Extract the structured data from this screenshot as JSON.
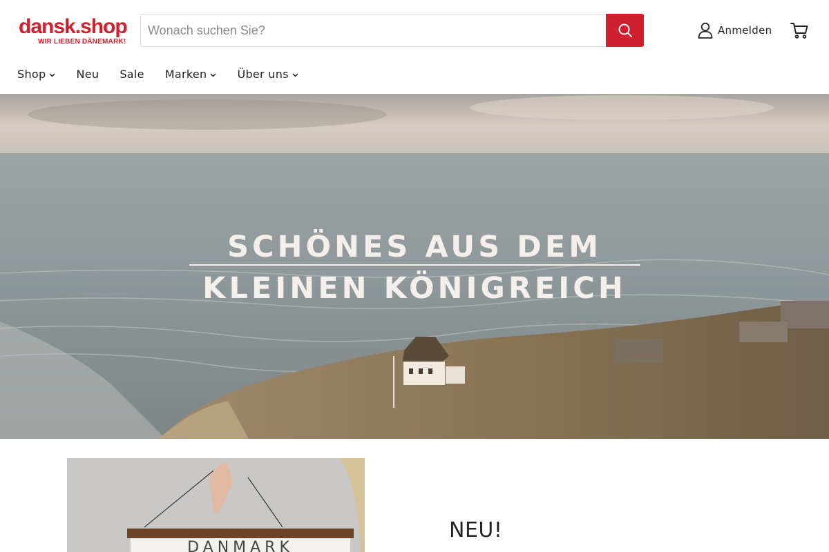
{
  "brand": {
    "logo_main": "dansk.shop",
    "logo_tagline": "WIR LIEBEN DÄNEMARK!",
    "color": "#d0202e"
  },
  "search": {
    "placeholder": "Wonach suchen Sie?",
    "value": "",
    "button_icon": "search-icon",
    "button_color": "#d0202e"
  },
  "account": {
    "label": "Anmelden",
    "icon": "user-icon"
  },
  "cart": {
    "icon": "cart-icon"
  },
  "nav": {
    "items": [
      {
        "label": "Shop",
        "has_dropdown": true
      },
      {
        "label": "Neu",
        "has_dropdown": false
      },
      {
        "label": "Sale",
        "has_dropdown": false
      },
      {
        "label": "Marken",
        "has_dropdown": true
      },
      {
        "label": "Über uns",
        "has_dropdown": true
      }
    ]
  },
  "hero": {
    "line1": "SCHÖNES AUS DEM",
    "line2": "KLEINEN KÖNIGREICH"
  },
  "feature": {
    "title": "NEU!",
    "poster_text": "DANMARK"
  }
}
